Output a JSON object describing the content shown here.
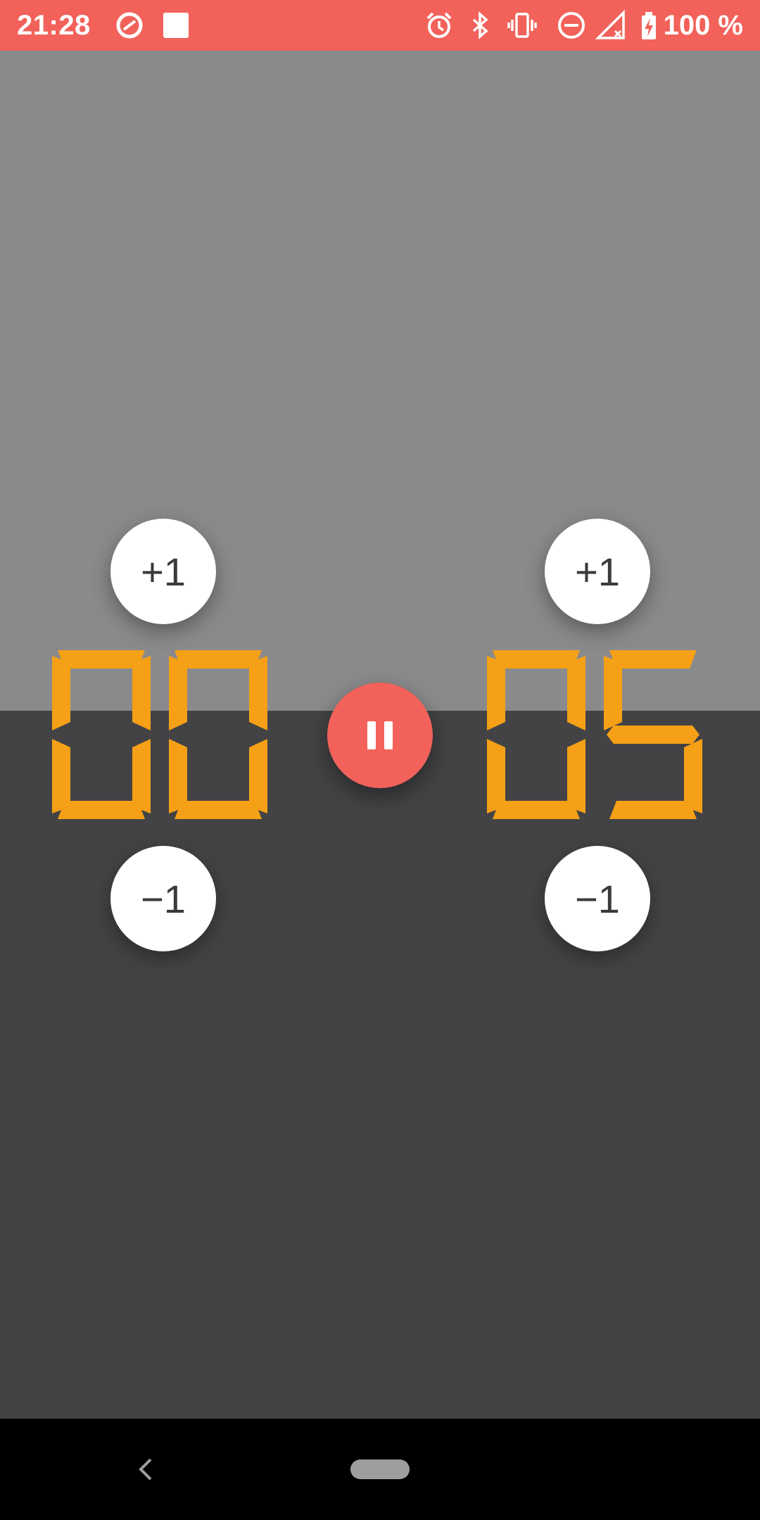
{
  "status_bar": {
    "time": "21:28",
    "battery": "100 %",
    "background": "#f2625a",
    "icons": [
      "sync-icon",
      "square-app-icon",
      "alarm-icon",
      "bluetooth-icon",
      "vibrate-icon",
      "do-not-disturb-icon",
      "no-signal-icon",
      "battery-charging-icon"
    ]
  },
  "scoreboard": {
    "upper_color": "#8a8a8c",
    "lower_color": "#434345",
    "digit_color": "#f5a016",
    "left": {
      "score": "00",
      "plus_label": "+1",
      "minus_label": "−1"
    },
    "right": {
      "score": "05",
      "plus_label": "+1",
      "minus_label": "−1"
    },
    "pause_button": {
      "icon": "pause-icon",
      "color": "#f2625a"
    }
  },
  "nav_bar": {
    "back_icon": "back-chevron-icon",
    "home_icon": "home-pill-icon"
  }
}
